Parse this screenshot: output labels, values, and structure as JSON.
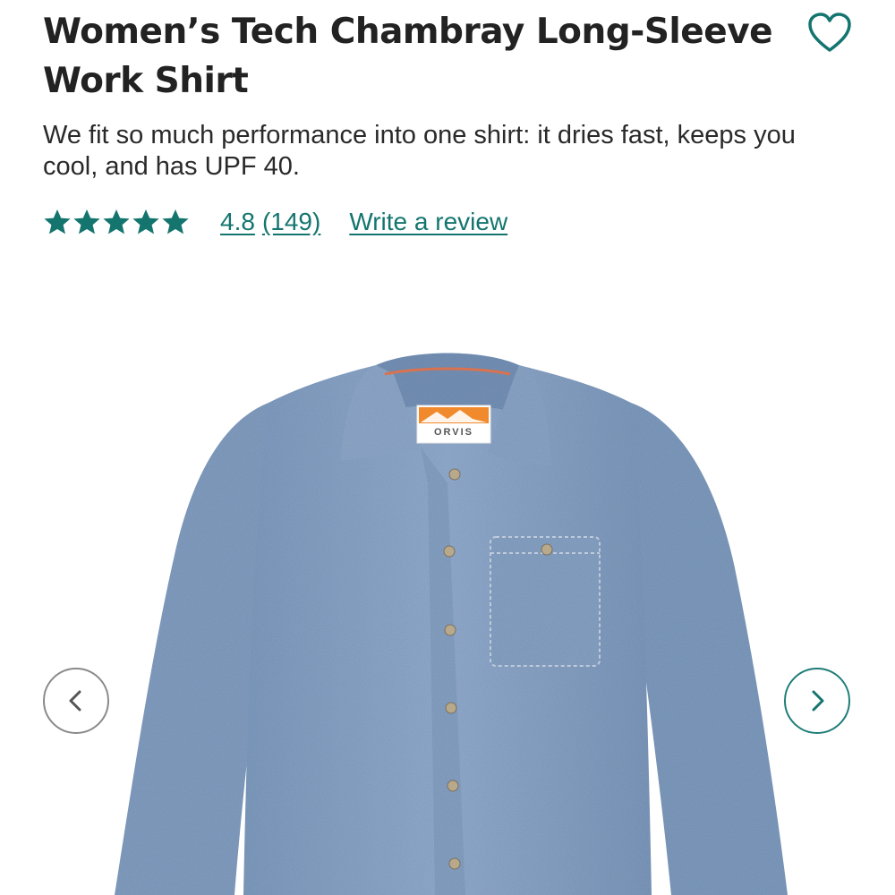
{
  "product": {
    "title": "Women’s Tech Chambray Long-Sleeve Work Shirt",
    "description": "We fit so much performance into one shirt: it dries fast, keeps you cool, and has UPF 40.",
    "rating": "4.8",
    "review_count": "(149)",
    "write_review_label": "Write a review",
    "stars_filled": 5,
    "label_brand": "ORVIS"
  },
  "colors": {
    "accent": "#14756f",
    "star": "#14756f",
    "shirt": "#8aa6c6",
    "label_orange": "#f08a2c"
  },
  "icons": {
    "favorite": "heart-outline-icon",
    "prev": "chevron-left-icon",
    "next": "chevron-right-icon",
    "star": "star-icon"
  }
}
